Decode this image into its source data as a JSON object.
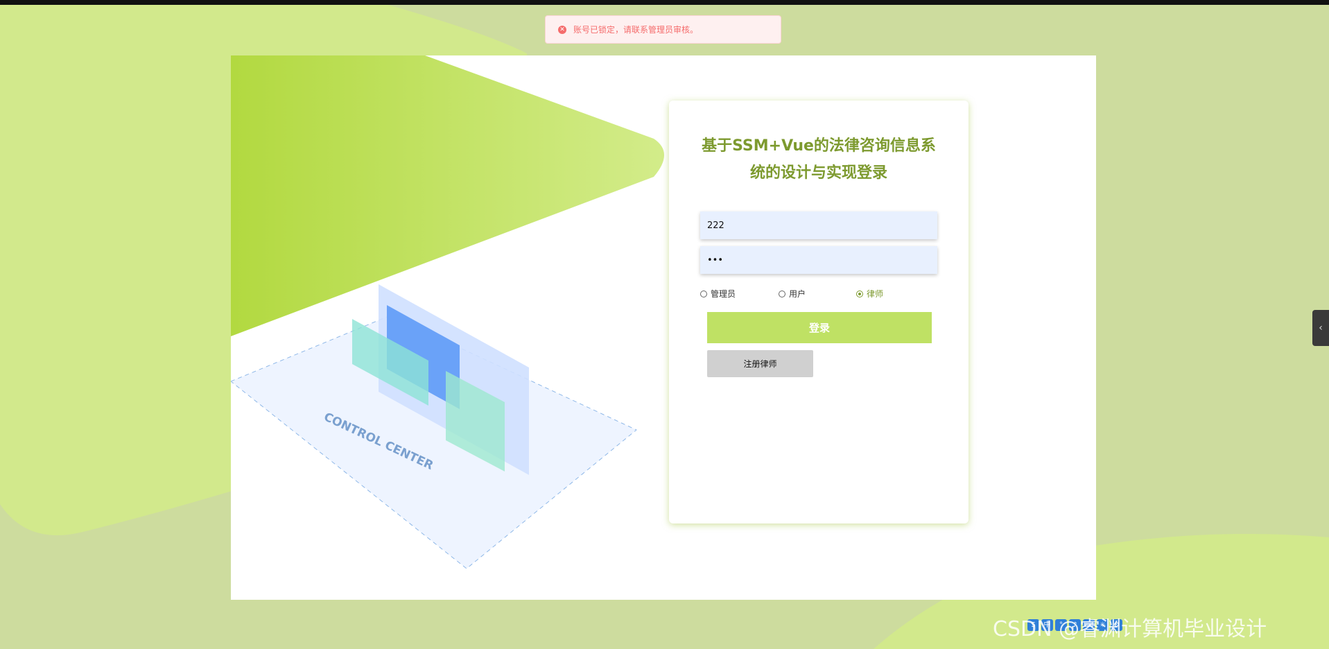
{
  "toast": {
    "icon": "close-circle-icon",
    "message": "账号已锁定，请联系管理员审核。"
  },
  "login": {
    "title": "基于SSM+Vue的法律咨询信息系统的设计与实现登录",
    "username_value": "222",
    "password_value": "•••",
    "roles": [
      {
        "label": "管理员",
        "checked": false
      },
      {
        "label": "用户",
        "checked": false
      },
      {
        "label": "律师",
        "checked": true
      }
    ],
    "login_label": "登录",
    "register_label": "注册律师"
  },
  "illustration": {
    "text": "CONTROL CENTER"
  },
  "watermark": "CSDN @睿渊计算机毕业设计",
  "colors": {
    "accent": "#bfe164",
    "title": "#7d9a2f",
    "error": "#f56c6c"
  }
}
